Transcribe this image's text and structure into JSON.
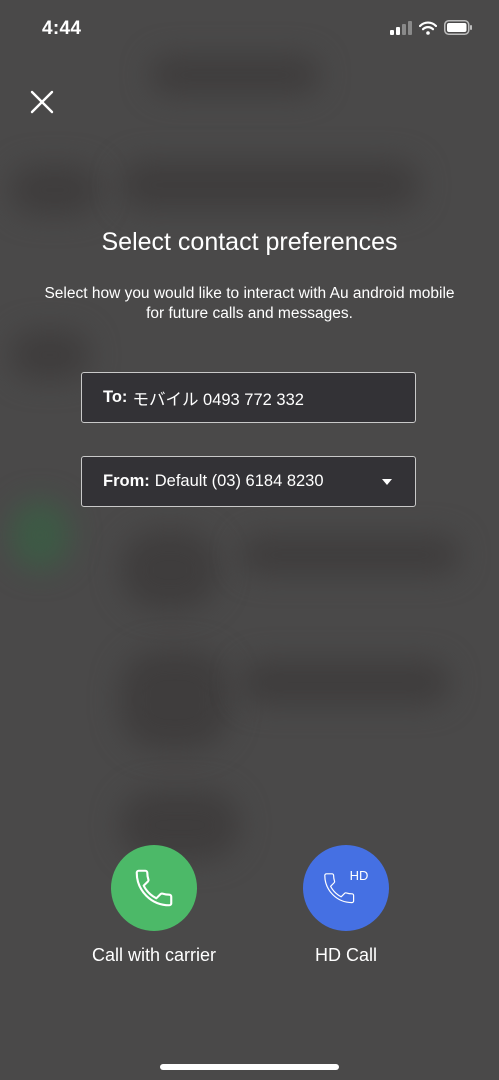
{
  "status_bar": {
    "time": "4:44",
    "icons": [
      "cellular-signal-icon",
      "wifi-icon",
      "battery-icon"
    ]
  },
  "header": {
    "close_icon": "close-icon",
    "title": "Select contact preferences",
    "subtitle": "Select how you would like to interact with Au android mobile for future calls and messages."
  },
  "to_field": {
    "label": "To:",
    "value": "モバイル 0493 772 332"
  },
  "from_field": {
    "label": "From:",
    "value": "Default (03) 6184 8230",
    "icon": "dropdown-arrow-icon"
  },
  "actions": {
    "carrier": {
      "label": "Call with carrier",
      "icon": "phone-icon",
      "color": "#4cb968"
    },
    "hd": {
      "label": "HD Call",
      "badge": "HD",
      "icon": "hd-phone-icon",
      "color": "#4570e3"
    }
  },
  "colors": {
    "overlay_background": "#4a4949",
    "field_background": "#333236",
    "text": "#ffffff"
  }
}
